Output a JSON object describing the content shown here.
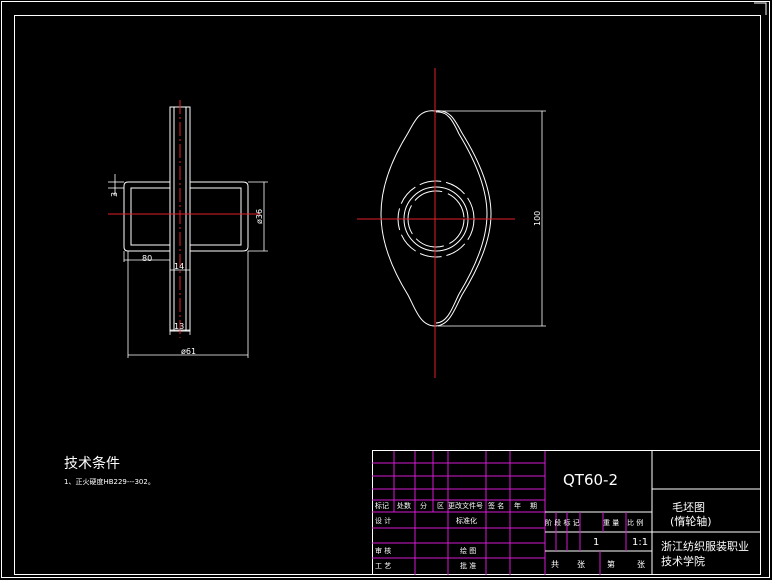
{
  "left_view": {
    "dim_top_3": "3",
    "dim_phi36": "ø36",
    "dim_80": "80",
    "dim_14": "14",
    "dim_13": "13",
    "dim_phi61": "ø61"
  },
  "right_view": {
    "dim_100": "100"
  },
  "notes": {
    "heading": "技术条件",
    "line1": "1、正火硬度HB229---302。"
  },
  "title_block": {
    "drawing_number": "QT60-2",
    "drawing_name_1": "毛坯图",
    "drawing_name_2": "(惰轮轴)",
    "school_1": "浙江纺织服装职业",
    "school_2": "技术学院",
    "scale": "1:1",
    "quantity": "1",
    "labels": {
      "mark": "标记",
      "count": "处数",
      "zone": "分",
      "region": "区",
      "change_doc": "更改文件号",
      "sign": "签 名",
      "year": "年",
      "date": "期",
      "design": "设 计",
      "standardize": "标准化",
      "stage_mark": "阶 段 标 记",
      "weight": "重 量",
      "scale": "比 例",
      "review": "审 核",
      "craft": "工 艺",
      "drawing_check": "绘 图",
      "approve": "批 准",
      "total": "共",
      "sheets": "张",
      "sheet_no": "第",
      "sheet_unit": "张"
    }
  }
}
